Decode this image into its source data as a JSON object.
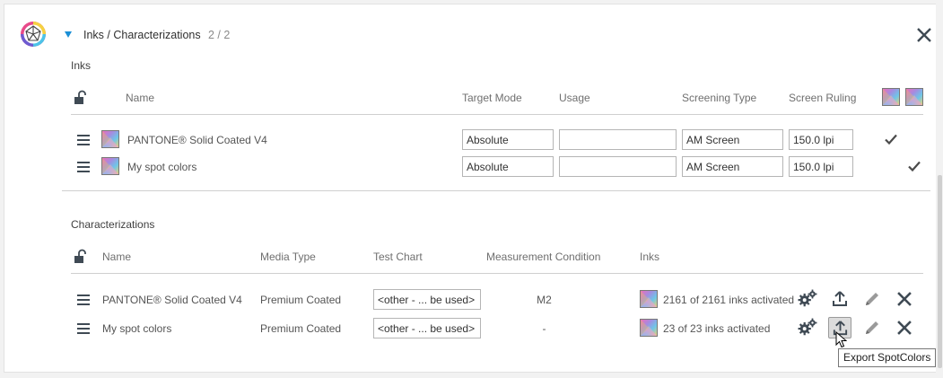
{
  "header": {
    "title": "Inks / Characterizations",
    "count": "2 / 2"
  },
  "inks": {
    "section_label": "Inks",
    "columns": {
      "name": "Name",
      "target_mode": "Target Mode",
      "usage": "Usage",
      "screening_type": "Screening Type",
      "screen_ruling": "Screen Ruling"
    },
    "rows": [
      {
        "name": "PANTONE® Solid Coated V4",
        "target_mode": "Absolute",
        "usage": "",
        "screening_type": "AM Screen",
        "screen_ruling": "150.0 lpi",
        "checked_column": 1
      },
      {
        "name": "My spot colors",
        "target_mode": "Absolute",
        "usage": "",
        "screening_type": "AM Screen",
        "screen_ruling": "150.0 lpi",
        "checked_column": 2
      }
    ]
  },
  "characterizations": {
    "section_label": "Characterizations",
    "columns": {
      "name": "Name",
      "media_type": "Media Type",
      "test_chart": "Test Chart",
      "measurement_condition": "Measurement Condition",
      "inks": "Inks"
    },
    "rows": [
      {
        "name": "PANTONE® Solid Coated V4",
        "media_type": "Premium Coated",
        "test_chart": "<other - ... be used>",
        "measurement_condition": "M2",
        "inks": "2161 of 2161 inks activated"
      },
      {
        "name": "My spot colors",
        "media_type": "Premium Coated",
        "test_chart": "<other - ... be used>",
        "measurement_condition": "-",
        "inks": "23 of 23 inks activated"
      }
    ]
  },
  "tooltip": "Export SpotColors",
  "icons": [
    "color-wheel-logo-icon",
    "expand-triangle-icon",
    "close-icon",
    "unlock-icon",
    "drag-handle-icon",
    "swatch-icon",
    "checkmark-icon",
    "settings-gears-icon",
    "export-upload-icon",
    "edit-pencil-icon",
    "delete-x-icon",
    "mouse-cursor-icon"
  ],
  "colors": {
    "accent": "#1a8fd6",
    "icon": "#3f4a54",
    "border": "#cfcfcf"
  }
}
